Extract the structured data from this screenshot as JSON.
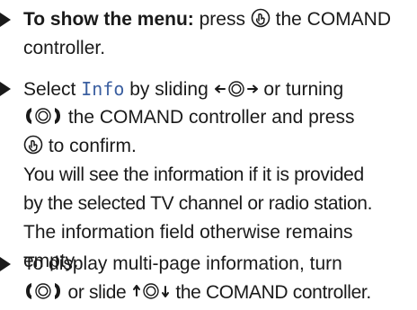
{
  "steps": [
    {
      "lines": [
        {
          "bold": "To show the menu:",
          "a": " press ",
          "b": " the COMAND"
        },
        {
          "text": "controller."
        }
      ]
    },
    {
      "lines": [
        {
          "a": "Select ",
          "display": "Info",
          "b": " by sliding ",
          "c": " or turning"
        },
        {
          "a": " the COMAND controller and press"
        },
        {
          "a": " to confirm."
        },
        {
          "text": "You will see the information if it is provided"
        },
        {
          "text": "by the selected TV channel or radio station."
        },
        {
          "text": "The information field otherwise remains"
        },
        {
          "text": "empty."
        }
      ]
    },
    {
      "lines": [
        {
          "text": "To display multi-page information, turn"
        },
        {
          "a": " or slide ",
          "b": " the COMAND controller."
        }
      ]
    }
  ],
  "icons": {
    "press": "press-controller-icon",
    "slide_lr": "slide-left-right-icon",
    "turn": "turn-controller-icon",
    "slide_ud": "slide-up-down-icon"
  }
}
